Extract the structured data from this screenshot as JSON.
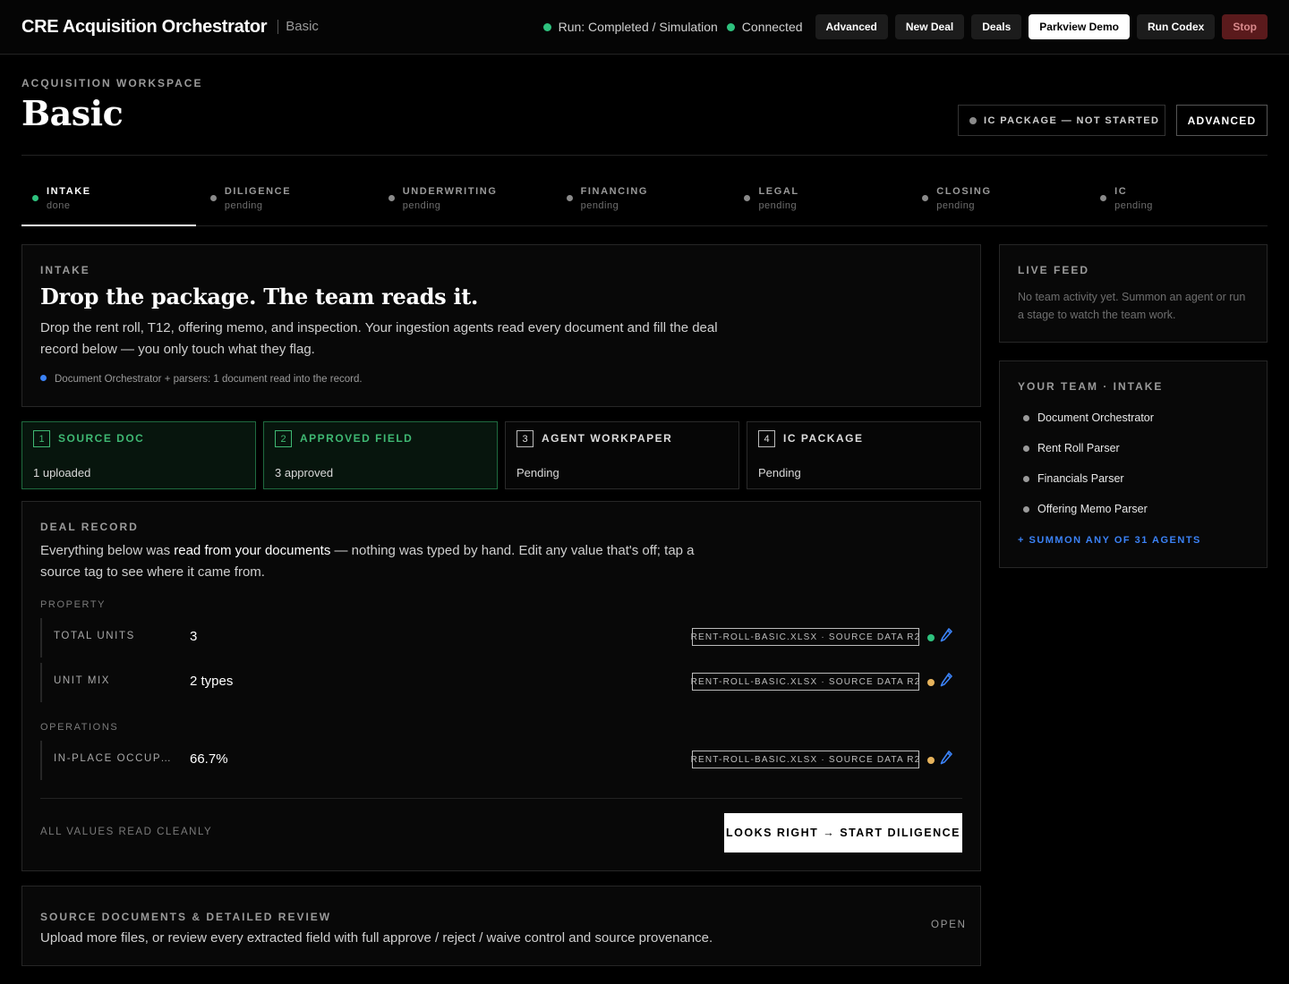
{
  "app": {
    "title": "CRE Acquisition Orchestrator",
    "mode": "Basic"
  },
  "topbar": {
    "run_status": "Run: Completed / Simulation",
    "connection_status": "Connected",
    "buttons": {
      "advanced": "Advanced",
      "new_deal": "New Deal",
      "deals": "Deals",
      "demo": "Parkview Demo",
      "run_codex": "Run Codex",
      "stop": "Stop"
    }
  },
  "header": {
    "eyebrow": "ACQUISITION WORKSPACE",
    "title": "Basic",
    "ic_status": "IC PACKAGE — NOT STARTED",
    "advanced_button": "ADVANCED"
  },
  "stages": [
    {
      "name": "INTAKE",
      "state": "done"
    },
    {
      "name": "DILIGENCE",
      "state": "pending"
    },
    {
      "name": "UNDERWRITING",
      "state": "pending"
    },
    {
      "name": "FINANCING",
      "state": "pending"
    },
    {
      "name": "LEGAL",
      "state": "pending"
    },
    {
      "name": "CLOSING",
      "state": "pending"
    },
    {
      "name": "IC",
      "state": "pending"
    }
  ],
  "intake": {
    "label": "INTAKE",
    "headline": "Drop the package. The team reads it.",
    "description": "Drop the rent roll, T12, offering memo, and inspection. Your ingestion agents read every document and fill the deal record below — you only touch what they flag.",
    "note": "Document Orchestrator + parsers: 1 document read into the record."
  },
  "steps": [
    {
      "num": "1",
      "title": "SOURCE DOC",
      "value": "1 uploaded"
    },
    {
      "num": "2",
      "title": "APPROVED FIELD",
      "value": "3 approved"
    },
    {
      "num": "3",
      "title": "AGENT WORKPAPER",
      "value": "Pending"
    },
    {
      "num": "4",
      "title": "IC PACKAGE",
      "value": "Pending"
    }
  ],
  "deal_record": {
    "label": "DEAL RECORD",
    "desc_before": "Everything below was ",
    "desc_highlight": "read from your documents",
    "desc_after": " — nothing was typed by hand. Edit any value that's off; tap a source tag to see where it came from.",
    "groups": {
      "property": "PROPERTY",
      "operations": "OPERATIONS"
    },
    "fields": [
      {
        "name": "TOTAL UNITS",
        "value": "3",
        "source": "RENT-ROLL-BASIC.XLSX · SOURCE DATA R2",
        "confidence_color": "#2ec27e"
      },
      {
        "name": "UNIT MIX",
        "value": "2 types",
        "source": "RENT-ROLL-BASIC.XLSX · SOURCE DATA R2",
        "confidence_color": "#e6b35c"
      },
      {
        "name": "IN-PLACE OCCUPAN…",
        "value": "66.7%",
        "source": "RENT-ROLL-BASIC.XLSX · SOURCE DATA R2",
        "confidence_color": "#e6b35c"
      }
    ],
    "footer_status": "ALL VALUES READ CLEANLY",
    "cta": "LOOKS RIGHT → START DILIGENCE"
  },
  "source_docs": {
    "label": "SOURCE DOCUMENTS & DETAILED REVIEW",
    "description": "Upload more files, or review every extracted field with full approve / reject / waive control and source provenance.",
    "open": "OPEN"
  },
  "live_feed": {
    "label": "LIVE FEED",
    "empty": "No team activity yet. Summon an agent or run a stage to watch the team work."
  },
  "team": {
    "label": "YOUR TEAM · INTAKE",
    "agents": [
      "Document Orchestrator",
      "Rent Roll Parser",
      "Financials Parser",
      "Offering Memo Parser"
    ],
    "summon": "+ SUMMON ANY OF 31 AGENTS"
  }
}
